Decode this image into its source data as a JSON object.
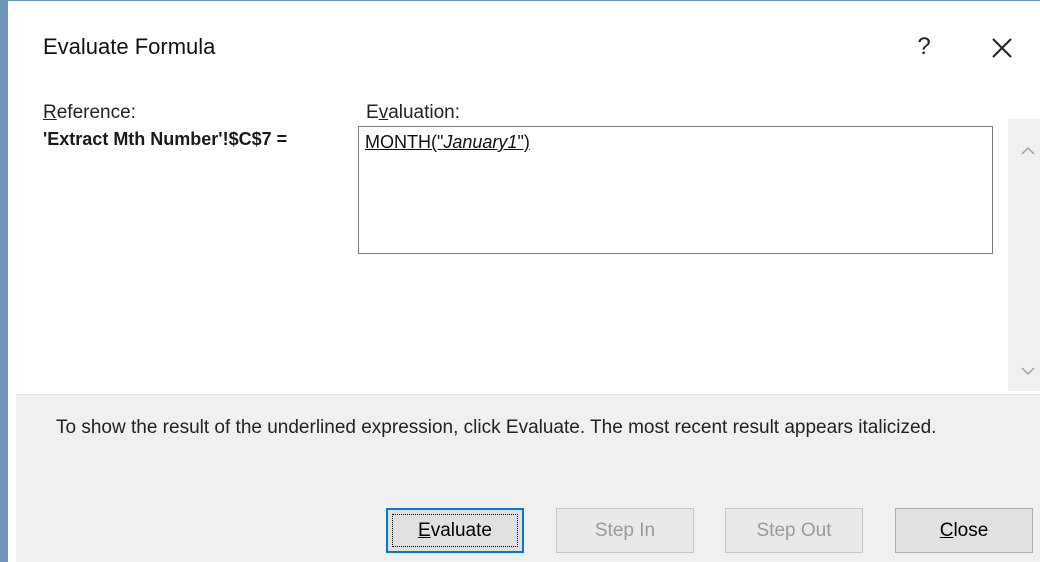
{
  "window": {
    "title": "Evaluate Formula",
    "help_label": "?"
  },
  "reference": {
    "label_first": "R",
    "label_rest": "eference:",
    "value": "'Extract Mth Number'!$C$7 ="
  },
  "evaluation": {
    "label_first": "E",
    "label_mnemonic": "v",
    "label_rest": "aluation:",
    "expr_prefix": "MONTH(\"",
    "expr_italic": "January1",
    "expr_suffix": "\")"
  },
  "hint": {
    "text": "To show the result of the underlined expression, click Evaluate.  The most recent result appears italicized."
  },
  "buttons": {
    "evaluate_mnemonic": "E",
    "evaluate_rest": "valuate",
    "step_in": "Step In",
    "step_out": "Step Out",
    "close_mnemonic": "C",
    "close_rest": "lose"
  },
  "icons": {
    "close": "close-x-icon",
    "scroll_up": "chevron-up-icon",
    "scroll_down": "chevron-down-icon"
  }
}
